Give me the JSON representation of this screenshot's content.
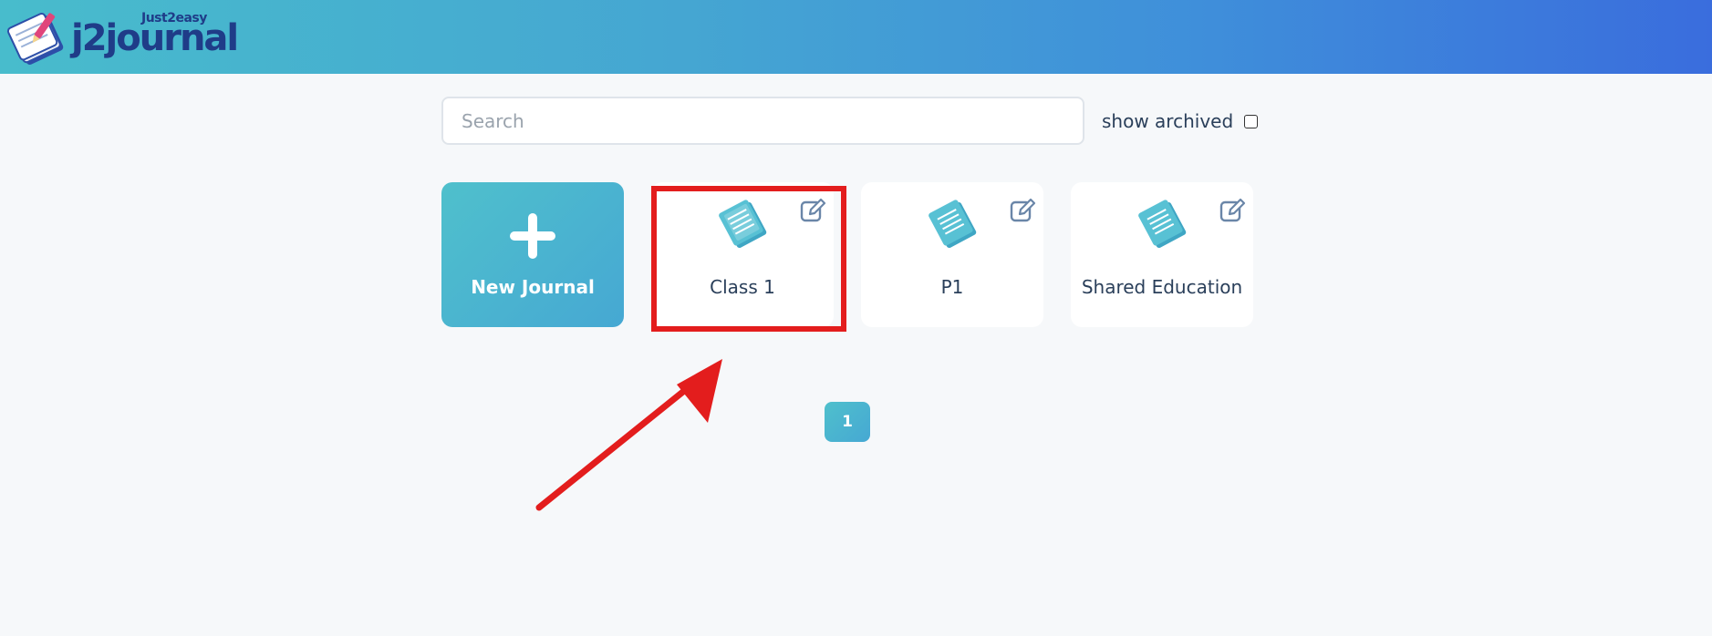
{
  "header": {
    "logo_small": "Just2easy",
    "logo_main": "j2journal",
    "logo_icon": "journal-stack-icon",
    "gradient_colors": [
      "#48bccc",
      "#3a6ddd"
    ]
  },
  "search": {
    "placeholder": "Search",
    "value": ""
  },
  "archived": {
    "label": "show archived",
    "checked": false
  },
  "cards": {
    "new_journal": {
      "label": "New Journal",
      "icon": "plus-icon"
    },
    "journals": [
      {
        "label": "Class 1",
        "icon": "journal-icon",
        "edit_icon": "edit-icon"
      },
      {
        "label": "P1",
        "icon": "journal-icon",
        "edit_icon": "edit-icon"
      },
      {
        "label": "Shared Education",
        "icon": "journal-icon",
        "edit_icon": "edit-icon"
      }
    ]
  },
  "pagination": {
    "current_page": "1"
  },
  "annotation": {
    "highlight_color": "#e31d1d",
    "arrow_color": "#e31d1d",
    "highlighted_item": "Class 1"
  }
}
